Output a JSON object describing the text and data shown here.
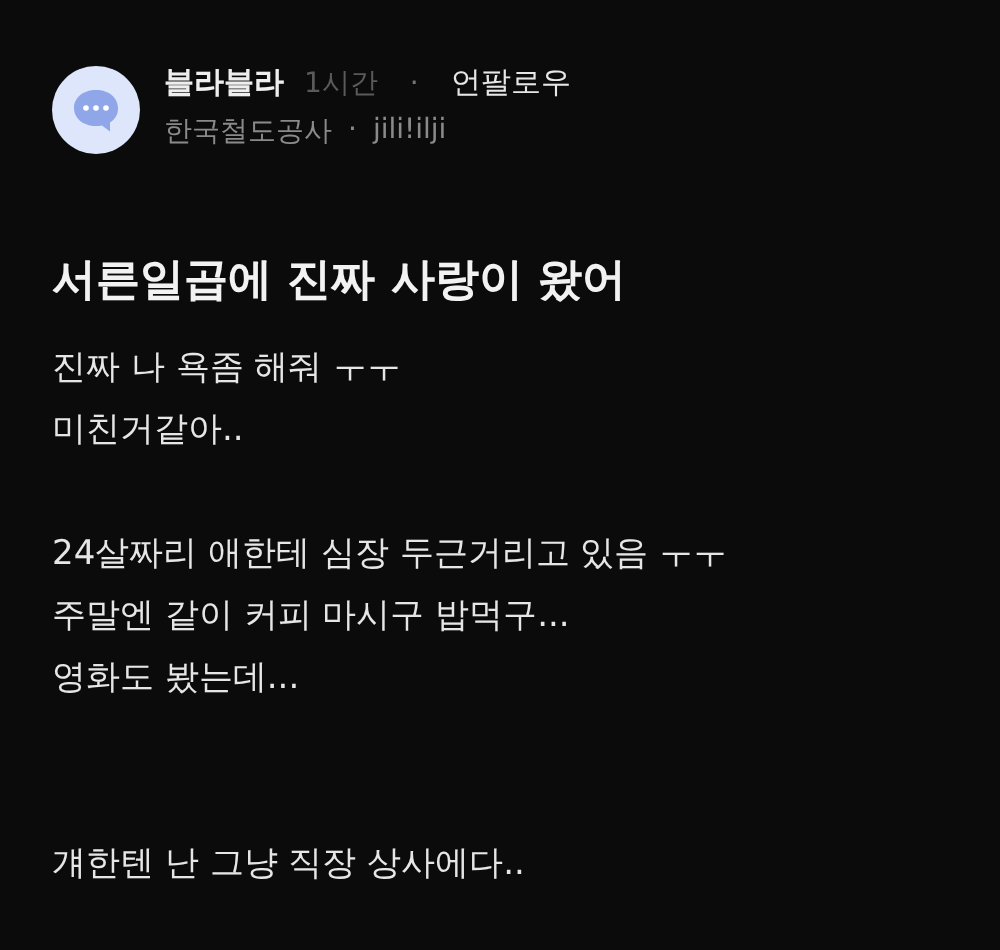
{
  "post": {
    "author": "블라블라",
    "time": "1시간",
    "separator": "·",
    "action": "언팔로우",
    "company": "한국철도공사",
    "company_separator": "·",
    "user_id": "jili!ilji"
  },
  "title": "서른일곱에 진짜 사랑이 왔어",
  "paragraphs": [
    {
      "lines": [
        "진짜 나 욕좀 해줘 ㅜㅜ",
        "미친거같아.."
      ]
    },
    {
      "lines": [
        "24살짜리 애한테 심장 두근거리고 있음 ㅜㅜ",
        "주말엔 같이 커피 마시구 밥먹구...",
        "영화도 봤는데..."
      ]
    },
    {
      "lines": [
        "걔한텐 난 그냥 직장 상사에다.."
      ]
    }
  ]
}
